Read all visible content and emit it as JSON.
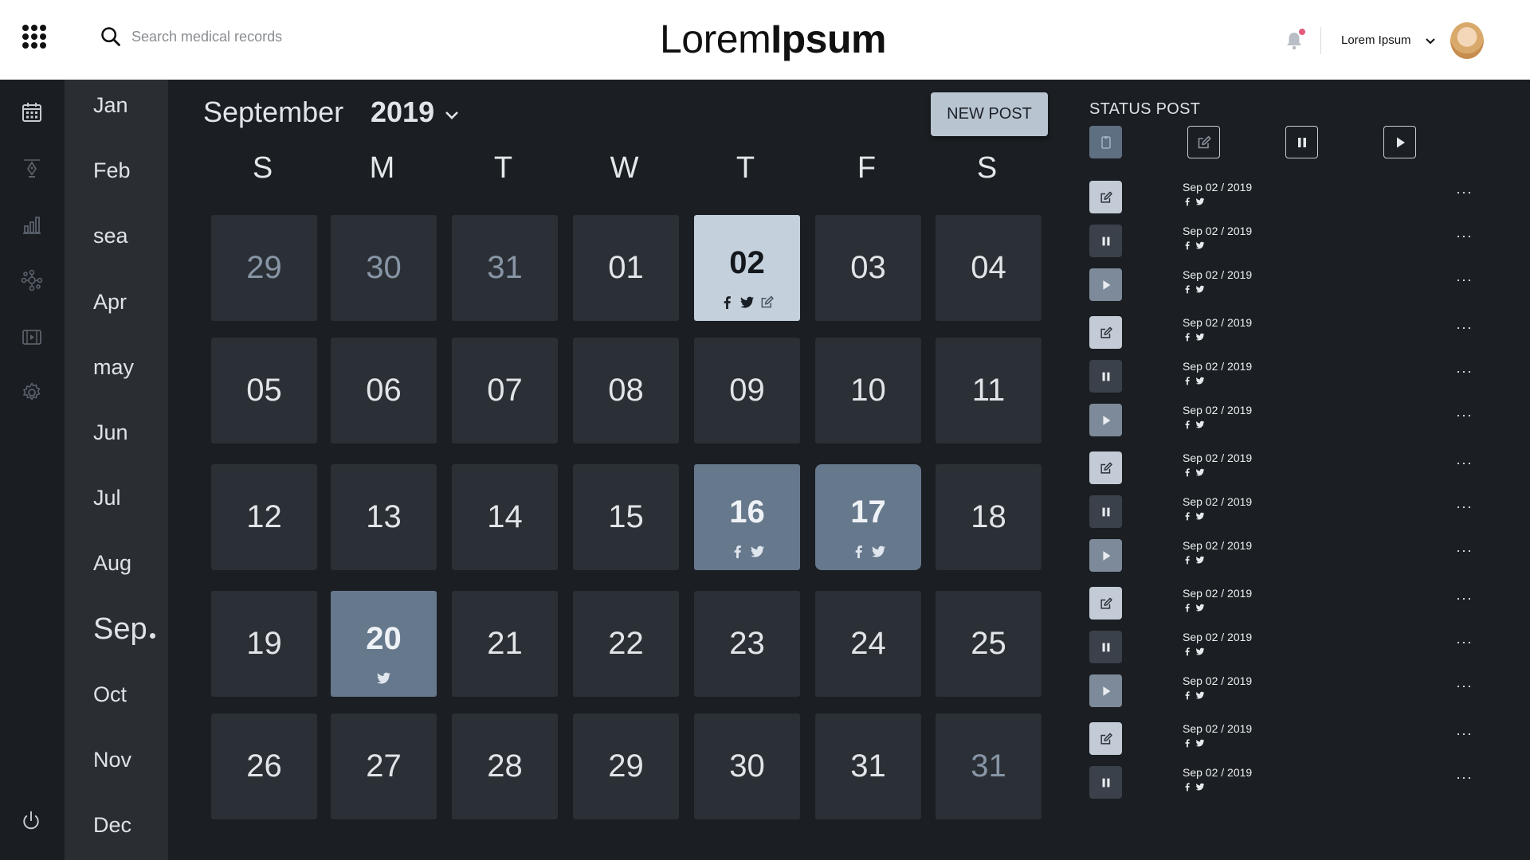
{
  "header": {
    "search_placeholder": "Search medical records",
    "brand_light": "Lorem",
    "brand_bold": "Ipsum",
    "user_name": "Lorem Ipsum"
  },
  "months": [
    "Jan",
    "Feb",
    "sea",
    "Apr",
    "may",
    "Jun",
    "Jul",
    "Aug",
    "Sep",
    "Oct",
    "Nov",
    "Dec"
  ],
  "active_month": "Sep",
  "calendar": {
    "month": "September",
    "year": "2019",
    "new_post_label": "NEW POST",
    "weekdays": [
      "S",
      "M",
      "T",
      "W",
      "T",
      "F",
      "S"
    ],
    "weeks": [
      [
        {
          "n": "29",
          "state": "muted"
        },
        {
          "n": "30",
          "state": "muted"
        },
        {
          "n": "31",
          "state": "muted"
        },
        {
          "n": "01"
        },
        {
          "n": "02",
          "state": "selected",
          "icons": [
            "facebook-icon",
            "twitter-icon",
            "edit-icon"
          ]
        },
        {
          "n": "03"
        },
        {
          "n": "04"
        }
      ],
      [
        {
          "n": "05"
        },
        {
          "n": "06"
        },
        {
          "n": "07"
        },
        {
          "n": "08"
        },
        {
          "n": "09"
        },
        {
          "n": "10"
        },
        {
          "n": "11"
        }
      ],
      [
        {
          "n": "12"
        },
        {
          "n": "13"
        },
        {
          "n": "14"
        },
        {
          "n": "15"
        },
        {
          "n": "16",
          "state": "scheduled",
          "icons": [
            "facebook-icon",
            "twitter-icon"
          ]
        },
        {
          "n": "17",
          "state": "scheduled",
          "icons": [
            "facebook-icon",
            "twitter-icon"
          ]
        },
        {
          "n": "18"
        }
      ],
      [
        {
          "n": "19"
        },
        {
          "n": "20",
          "state": "scheduled",
          "icons": [
            "twitter-icon"
          ]
        },
        {
          "n": "21"
        },
        {
          "n": "22"
        },
        {
          "n": "23"
        },
        {
          "n": "24"
        },
        {
          "n": "25"
        }
      ],
      [
        {
          "n": "26"
        },
        {
          "n": "27"
        },
        {
          "n": "28"
        },
        {
          "n": "29"
        },
        {
          "n": "30"
        },
        {
          "n": "31"
        },
        {
          "n": "31",
          "state": "muted"
        }
      ]
    ]
  },
  "status": {
    "title": "STATUS POST",
    "filters": [
      "clipboard-icon",
      "edit-icon",
      "pause-icon",
      "play-icon"
    ],
    "posts": [
      {
        "status": "edit-icon",
        "date": "Sep 02 / 2019"
      },
      {
        "status": "pause-icon",
        "date": "Sep 02 / 2019"
      },
      {
        "status": "play-icon",
        "date": "Sep 02 / 2019"
      },
      {
        "status": "edit-icon",
        "date": "Sep 02 / 2019"
      },
      {
        "status": "pause-icon",
        "date": "Sep 02 / 2019"
      },
      {
        "status": "play-icon",
        "date": "Sep 02 / 2019"
      },
      {
        "status": "edit-icon",
        "date": "Sep 02 / 2019"
      },
      {
        "status": "pause-icon",
        "date": "Sep 02 / 2019"
      },
      {
        "status": "play-icon",
        "date": "Sep 02 / 2019"
      },
      {
        "status": "edit-icon",
        "date": "Sep 02 / 2019"
      },
      {
        "status": "pause-icon",
        "date": "Sep 02 / 2019"
      },
      {
        "status": "play-icon",
        "date": "Sep 02 / 2019"
      },
      {
        "status": "edit-icon",
        "date": "Sep 02 / 2019"
      },
      {
        "status": "pause-icon",
        "date": "Sep 02 / 2019"
      }
    ],
    "more_label": "···"
  },
  "colors": {
    "background": "#1b1e22",
    "tile": "#2b3036",
    "selected_tile": "#c4d0dc",
    "scheduled_tile": "#66788c",
    "accent_button": "#b9c4d1",
    "notification_dot": "#e25b7a"
  }
}
